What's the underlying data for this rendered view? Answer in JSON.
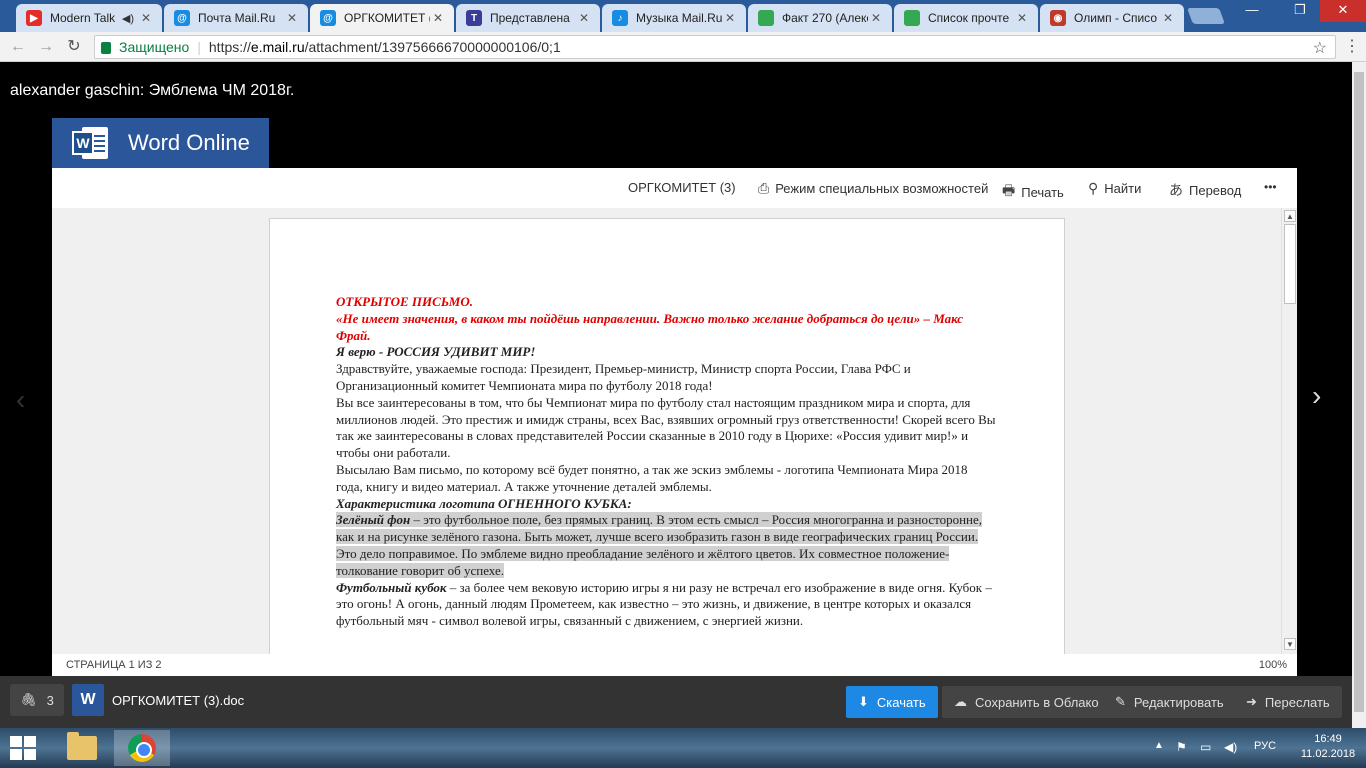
{
  "browser": {
    "tabs": [
      {
        "label": "Modern Talk",
        "favicon_color": "#e52d27",
        "active": false,
        "audio": true
      },
      {
        "label": "Почта Mail.Ru",
        "favicon_color": "#168de2",
        "active": false
      },
      {
        "label": "ОРГКОМИТЕТ (",
        "favicon_color": "#168de2",
        "active": true
      },
      {
        "label": "Представлена",
        "favicon_color": "#3b3b98",
        "active": false
      },
      {
        "label": "Музыка Mail.Ru",
        "favicon_color": "#168de2",
        "active": false
      },
      {
        "label": "Факт 270 (Алекс",
        "favicon_color": "#34a853",
        "active": false
      },
      {
        "label": "Список прочте",
        "favicon_color": "#34a853",
        "active": false
      },
      {
        "label": "Олимп - Списо",
        "favicon_color": "#c0392b",
        "active": false
      }
    ],
    "close_glyph": "✕",
    "audio_glyph": "◀)",
    "window": {
      "minimize": "—",
      "maximize": "❐",
      "close": "✕"
    },
    "nav": {
      "back": "←",
      "forward": "→",
      "reload": "↻"
    },
    "secure_label": "Защищено",
    "url_scheme": "https://",
    "url_host": "e.mail.ru",
    "url_path": "/attachment/13975666670000000106/0;1",
    "star_glyph": "☆",
    "menu_glyph": "⋮"
  },
  "viewer": {
    "attachment_title": "alexander gaschin: Эмблема ЧМ 2018г.",
    "word_brand": "Word Online",
    "commands": {
      "doc_name": "ОРГКОМИТЕТ (3)",
      "accessibility": "Режим специальных возможностей",
      "print": "Печать",
      "find": "Найти",
      "translate": "Перевод",
      "more": "•••"
    },
    "status_left": "СТРАНИЦА 1 ИЗ 2",
    "status_right": "100%",
    "prev_glyph": "‹",
    "next_glyph": "›"
  },
  "document": {
    "line1": "ОТКРЫТОЕ ПИСЬМО.",
    "line2": "«Не имеет значения, в каком ты пойдёшь направлении. Важно только желание добраться до цели» – Макс Фрай.",
    "line3": "Я верю - РОССИЯ УДИВИТ МИР!",
    "p1": "Здравствуйте, уважаемые господа: Президент, Премьер-министр, Министр  спорта России, Глава РФС и Организационный  комитет Чемпионата мира по  футболу 2018 года!",
    "p2": "Вы все заинтересованы в том, что бы Чемпионат мира по футболу стал настоящим праздником  мира и спорта, для миллионов  людей. Это престиж и имидж страны, всех Вас, взявших огромный груз ответственности! Скорей всего Вы так же заинтересованы в словах представителей России сказанные в 2010 году в Цюрихе:  «Россия удивит мир!»  и чтобы они работали.",
    "p3": "Высылаю Вам письмо, по которому всё будет понятно,  а так же эскиз эмблемы - логотипа  Чемпионата Мира 2018 года, книгу  и видео материал. А также уточнение деталей эмблемы.",
    "heading": "Характеристика логотипа ОГНЕННОГО КУБКА:",
    "p4_lead": "Зелёный фон",
    "p4": " – это футбольное поле, без прямых границ.  В этом есть смысл – Россия многогранна и разносторонне,  как и на рисунке  зелёного газона. Быть может, лучше всего изобразить газон в виде географических границ  России. Это дело поправимое.  По эмблеме видно преобладание зелёного и жёлтого цветов. Их совместное положение-толкование  говорит  об успехе.",
    "p5_lead": "Футбольный кубок",
    "p5": " – за более чем вековую историю игры я ни разу не встречал его изображение в виде огня. Кубок – это огонь!  А огонь, данный людям Прометеем, как известно – это жизнь,  и движение,  в центре которых и оказался футбольный мяч - символ волевой игры,  связанный с движением,  с энергией жизни."
  },
  "bottom_bar": {
    "attach_count": "3",
    "file_icon_letter": "W",
    "file_name": "ОРГКОМИТЕТ (3).doc",
    "download": "Скачать",
    "save_cloud": "Сохранить в Облако",
    "edit": "Редактировать",
    "forward": "Переслать"
  },
  "taskbar": {
    "lang": "РУС",
    "time": "16:49",
    "date": "11.02.2018"
  }
}
